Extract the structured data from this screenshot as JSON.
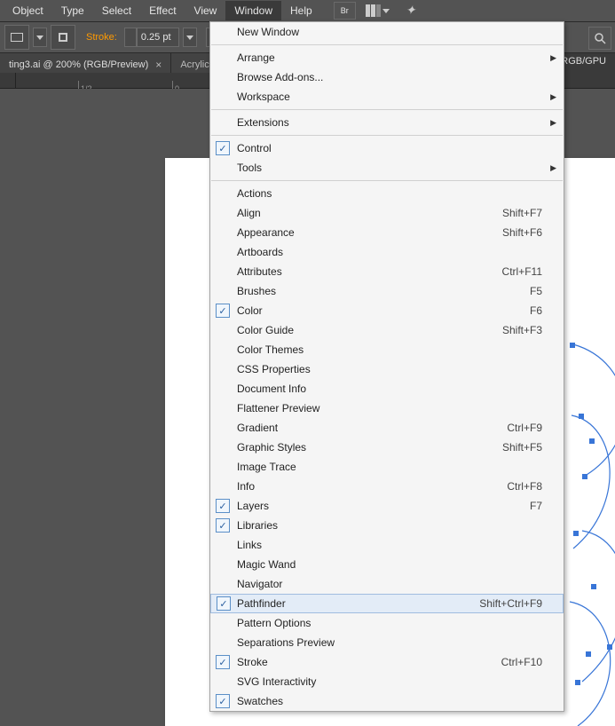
{
  "menubar": {
    "items": [
      "Object",
      "Type",
      "Select",
      "Effect",
      "View",
      "Window",
      "Help"
    ],
    "active_index": 5,
    "bridge_label": "Br"
  },
  "toolbar": {
    "stroke_label": "Stroke:",
    "stroke_value": "0.25 pt"
  },
  "tabs": {
    "tab1": "ting3.ai @ 200% (RGB/Preview)",
    "tab2": "Acrylic",
    "mode": "RGB/GPU"
  },
  "ruler": {
    "half_label": "1/2",
    "zero_label": "0"
  },
  "menu": [
    {
      "type": "item",
      "label": "New Window"
    },
    {
      "type": "sep"
    },
    {
      "type": "item",
      "label": "Arrange",
      "submenu": true
    },
    {
      "type": "item",
      "label": "Browse Add-ons..."
    },
    {
      "type": "item",
      "label": "Workspace",
      "submenu": true
    },
    {
      "type": "sep"
    },
    {
      "type": "item",
      "label": "Extensions",
      "submenu": true
    },
    {
      "type": "sep"
    },
    {
      "type": "item",
      "label": "Control",
      "checked": true
    },
    {
      "type": "item",
      "label": "Tools",
      "submenu": true
    },
    {
      "type": "sep"
    },
    {
      "type": "item",
      "label": "Actions"
    },
    {
      "type": "item",
      "label": "Align",
      "shortcut": "Shift+F7"
    },
    {
      "type": "item",
      "label": "Appearance",
      "shortcut": "Shift+F6"
    },
    {
      "type": "item",
      "label": "Artboards"
    },
    {
      "type": "item",
      "label": "Attributes",
      "shortcut": "Ctrl+F11"
    },
    {
      "type": "item",
      "label": "Brushes",
      "shortcut": "F5"
    },
    {
      "type": "item",
      "label": "Color",
      "shortcut": "F6",
      "checked": true
    },
    {
      "type": "item",
      "label": "Color Guide",
      "shortcut": "Shift+F3"
    },
    {
      "type": "item",
      "label": "Color Themes"
    },
    {
      "type": "item",
      "label": "CSS Properties"
    },
    {
      "type": "item",
      "label": "Document Info"
    },
    {
      "type": "item",
      "label": "Flattener Preview"
    },
    {
      "type": "item",
      "label": "Gradient",
      "shortcut": "Ctrl+F9"
    },
    {
      "type": "item",
      "label": "Graphic Styles",
      "shortcut": "Shift+F5"
    },
    {
      "type": "item",
      "label": "Image Trace"
    },
    {
      "type": "item",
      "label": "Info",
      "shortcut": "Ctrl+F8"
    },
    {
      "type": "item",
      "label": "Layers",
      "shortcut": "F7",
      "checked": true
    },
    {
      "type": "item",
      "label": "Libraries",
      "checked": true
    },
    {
      "type": "item",
      "label": "Links"
    },
    {
      "type": "item",
      "label": "Magic Wand"
    },
    {
      "type": "item",
      "label": "Navigator"
    },
    {
      "type": "item",
      "label": "Pathfinder",
      "shortcut": "Shift+Ctrl+F9",
      "checked": true,
      "highlighted": true
    },
    {
      "type": "item",
      "label": "Pattern Options"
    },
    {
      "type": "item",
      "label": "Separations Preview"
    },
    {
      "type": "item",
      "label": "Stroke",
      "shortcut": "Ctrl+F10",
      "checked": true
    },
    {
      "type": "item",
      "label": "SVG Interactivity"
    },
    {
      "type": "item",
      "label": "Swatches",
      "checked": true
    }
  ]
}
